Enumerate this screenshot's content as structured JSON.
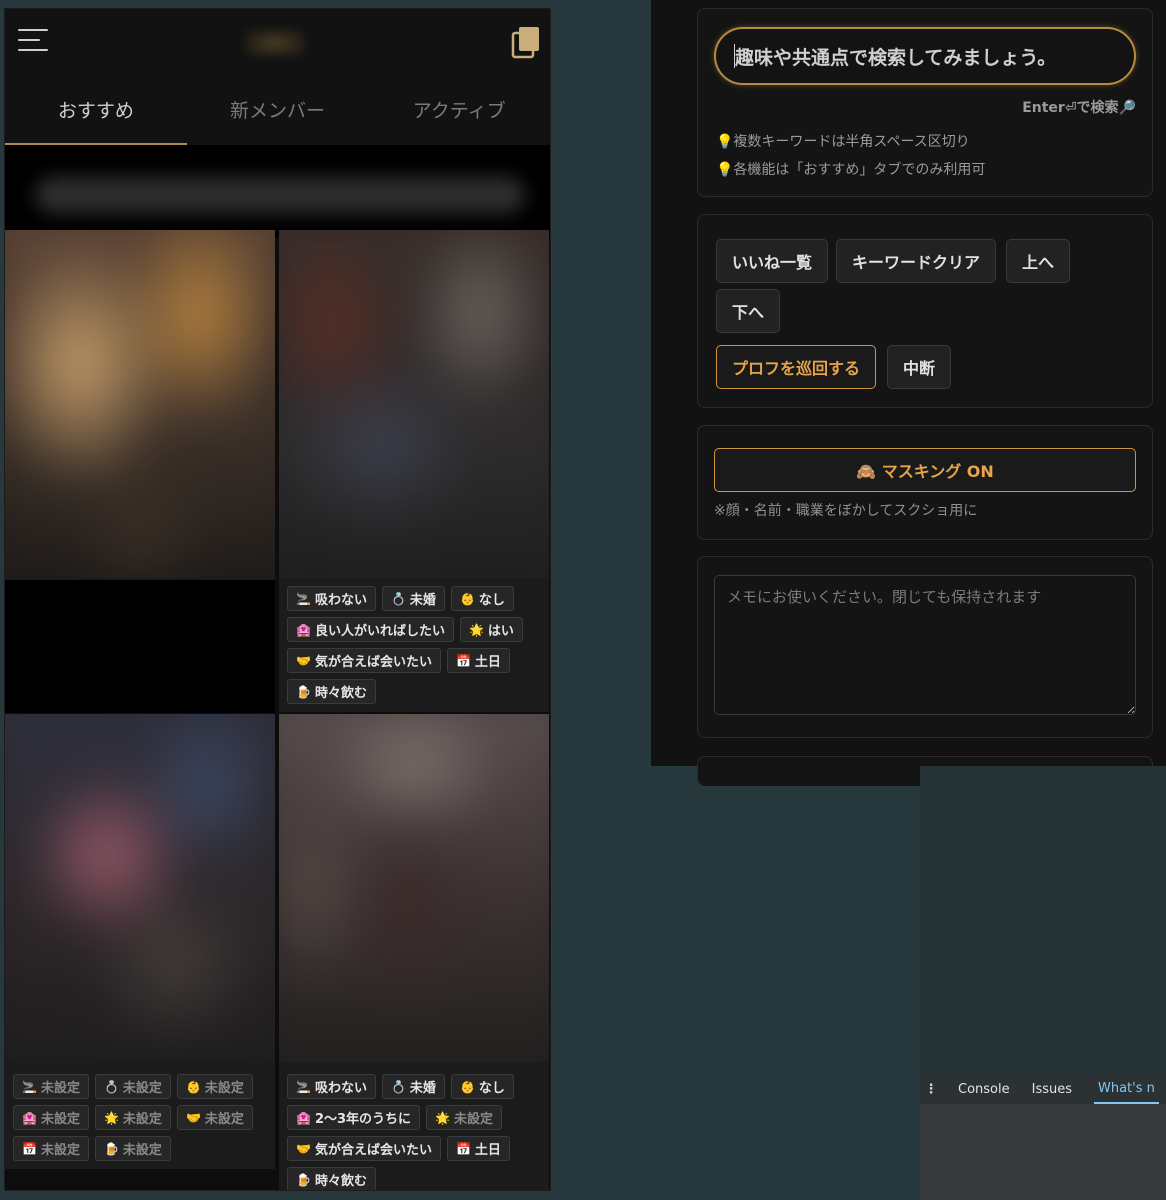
{
  "app": {
    "tabs": [
      {
        "label": "おすすめ",
        "active": true
      },
      {
        "label": "新メンバー",
        "active": false
      },
      {
        "label": "アクティブ",
        "active": false
      }
    ],
    "cards": [
      {
        "tags": []
      },
      {
        "tags": [
          {
            "icon": "🚬",
            "label": "吸わない"
          },
          {
            "icon": "💍",
            "label": "未婚"
          },
          {
            "icon": "👶",
            "label": "なし"
          },
          {
            "icon": "🏩",
            "label": "良い人がいればしたい"
          },
          {
            "icon": "🌟",
            "label": "はい"
          },
          {
            "icon": "🤝",
            "label": "気が合えば会いたい"
          },
          {
            "icon": "📅",
            "label": "土日"
          },
          {
            "icon": "🍺",
            "label": "時々飲む"
          }
        ]
      },
      {
        "tags": [
          {
            "icon": "🚬",
            "label": "未設定"
          },
          {
            "icon": "💍",
            "label": "未設定"
          },
          {
            "icon": "👶",
            "label": "未設定"
          },
          {
            "icon": "🏩",
            "label": "未設定"
          },
          {
            "icon": "🌟",
            "label": "未設定"
          },
          {
            "icon": "🤝",
            "label": "未設定"
          },
          {
            "icon": "📅",
            "label": "未設定"
          },
          {
            "icon": "🍺",
            "label": "未設定"
          }
        ]
      },
      {
        "tags": [
          {
            "icon": "🚬",
            "label": "吸わない"
          },
          {
            "icon": "💍",
            "label": "未婚"
          },
          {
            "icon": "👶",
            "label": "なし"
          },
          {
            "icon": "🏩",
            "label": "2〜3年のうちに"
          },
          {
            "icon": "🌟",
            "label": "未設定"
          },
          {
            "icon": "🤝",
            "label": "気が合えば会いたい"
          },
          {
            "icon": "📅",
            "label": "土日"
          },
          {
            "icon": "🍺",
            "label": "時々飲む"
          }
        ]
      }
    ]
  },
  "extension": {
    "search": {
      "value": "趣味や共通点で検索してみましょう。",
      "enter_hint": "Enter⏎で検索🔎",
      "tips": [
        "💡複数キーワードは半角スペース区切り",
        "💡各機能は「おすすめ」タブでのみ利用可"
      ]
    },
    "buttons": {
      "likes": "いいね一覧",
      "clear": "キーワードクリア",
      "up": "上へ",
      "down": "下へ",
      "patrol": "プロフを巡回する",
      "stop": "中断"
    },
    "masking": {
      "label": "🙈 マスキング ON",
      "note": "※顔・名前・職業をぼかしてスクショ用に"
    },
    "memo": {
      "placeholder": "メモにお使いください。閉じても保持されます"
    }
  },
  "devtools": {
    "tabs": [
      "Console",
      "Issues",
      "What's n"
    ],
    "active_index": 2
  },
  "colors": {
    "accent_gold": "#b08a47",
    "button_orange": "#e8a44a",
    "devtools_active": "#84c8f1",
    "page_bg": "#27393d"
  }
}
